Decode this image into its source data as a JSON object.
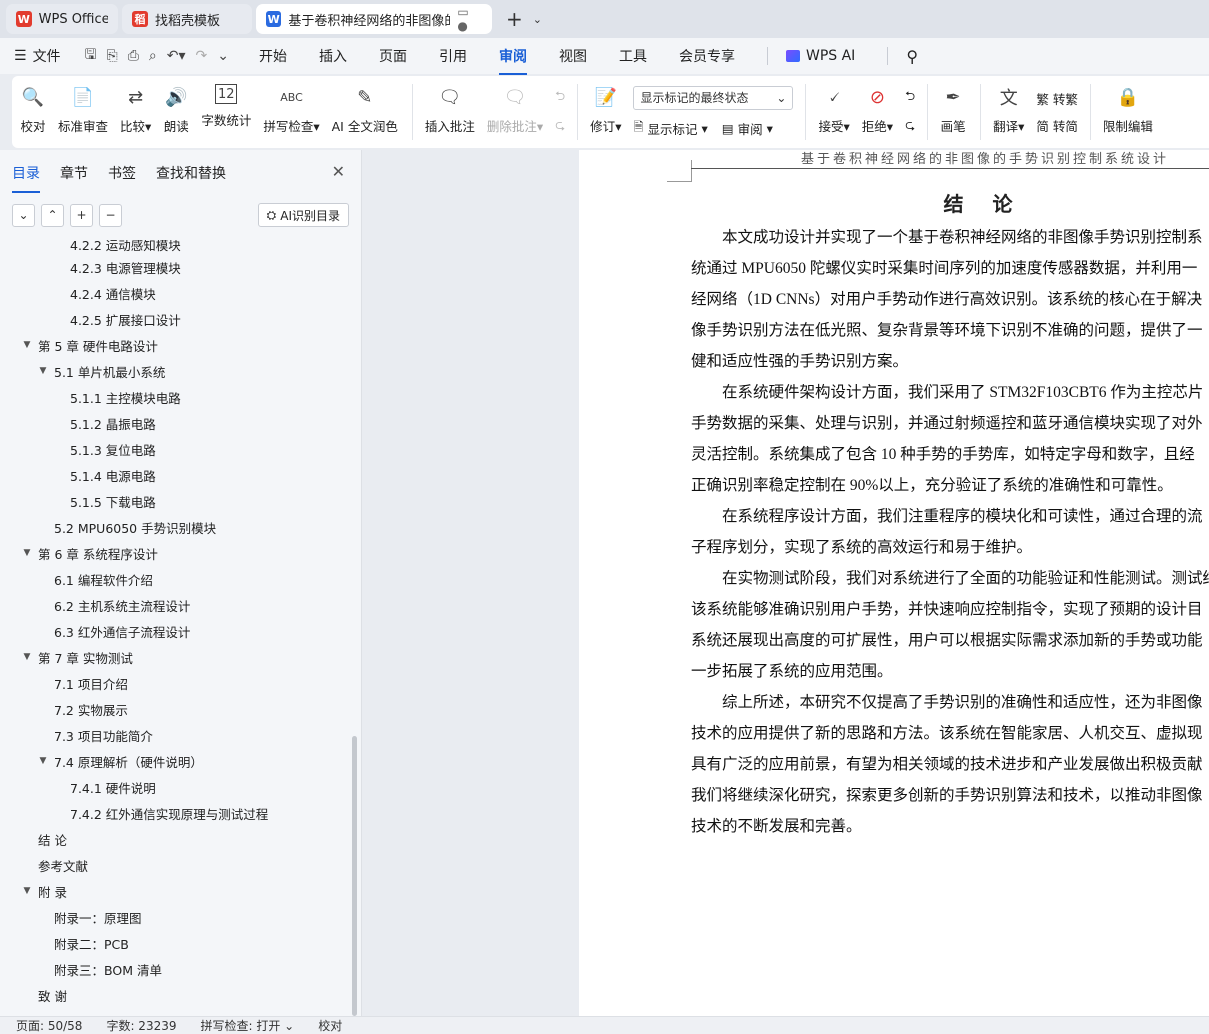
{
  "tabs": [
    {
      "label": "WPS Office",
      "logo": "W",
      "color": "#e23b2e"
    },
    {
      "label": "找稻壳模板",
      "logo": "稻",
      "color": "#e23b2e"
    },
    {
      "label": "基于卷积神经网络的非图像的",
      "logo": "W",
      "color": "#2b6be0",
      "active": true
    }
  ],
  "menu": {
    "file": "文件",
    "items": [
      "开始",
      "插入",
      "页面",
      "引用",
      "审阅",
      "视图",
      "工具",
      "会员专享"
    ],
    "active": "审阅",
    "ai": "WPS AI"
  },
  "ribbon": {
    "proof": "校对",
    "std_review": "标准审查",
    "compare": "比较",
    "read_aloud": "朗读",
    "word_count": "字数统计",
    "spell_check": "拼写检查",
    "ai_polish": "AI 全文润色",
    "insert_comment": "插入批注",
    "delete_comment": "删除批注",
    "revise": "修订",
    "markup_select": "显示标记的最终状态",
    "show_markup": "显示标记",
    "review": "审阅",
    "accept": "接受",
    "reject": "拒绝",
    "pen": "画笔",
    "translate": "翻译",
    "to_traditional": "转繁",
    "to_simplified": "转简",
    "restrict_edit": "限制编辑"
  },
  "sidebar": {
    "tabs": [
      "目录",
      "章节",
      "书签",
      "查找和替换"
    ],
    "active_tab": "目录",
    "ai_toc": "AI识别目录",
    "toc": [
      {
        "level": 3,
        "text": "4.2.2  运动感知模块",
        "arrow": ""
      },
      {
        "level": 3,
        "text": "4.2.3  电源管理模块",
        "arrow": ""
      },
      {
        "level": 3,
        "text": "4.2.4  通信模块",
        "arrow": ""
      },
      {
        "level": 3,
        "text": "4.2.5  扩展接口设计",
        "arrow": ""
      },
      {
        "level": 1,
        "text": "第 5 章  硬件电路设计",
        "arrow": "▼"
      },
      {
        "level": 2,
        "text": "5.1 单片机最小系统",
        "arrow": "▼"
      },
      {
        "level": 3,
        "text": "5.1.1 主控模块电路",
        "arrow": ""
      },
      {
        "level": 3,
        "text": "5.1.2  晶振电路",
        "arrow": ""
      },
      {
        "level": 3,
        "text": "5.1.3  复位电路",
        "arrow": ""
      },
      {
        "level": 3,
        "text": "5.1.4  电源电路",
        "arrow": ""
      },
      {
        "level": 3,
        "text": "5.1.5 下载电路",
        "arrow": ""
      },
      {
        "level": 2,
        "text": "5.2 MPU6050 手势识别模块",
        "arrow": ""
      },
      {
        "level": 1,
        "text": "第 6 章  系统程序设计",
        "arrow": "▼"
      },
      {
        "level": 2,
        "text": "6.1  编程软件介绍",
        "arrow": ""
      },
      {
        "level": 2,
        "text": "6.2  主机系统主流程设计",
        "arrow": ""
      },
      {
        "level": 2,
        "text": "6.3  红外通信子流程设计",
        "arrow": ""
      },
      {
        "level": 1,
        "text": "第 7 章  实物测试",
        "arrow": "▼"
      },
      {
        "level": 2,
        "text": "7.1  项目介绍",
        "arrow": ""
      },
      {
        "level": 2,
        "text": "7.2  实物展示",
        "arrow": ""
      },
      {
        "level": 2,
        "text": "7.3  项目功能简介",
        "arrow": ""
      },
      {
        "level": 2,
        "text": "7.4  原理解析（硬件说明）",
        "arrow": "▼"
      },
      {
        "level": 3,
        "text": "7.4.1 硬件说明",
        "arrow": ""
      },
      {
        "level": 3,
        "text": "7.4.2 红外通信实现原理与测试过程",
        "arrow": ""
      },
      {
        "level": 1,
        "text": "结    论",
        "arrow": ""
      },
      {
        "level": 1,
        "text": "参考文献",
        "arrow": ""
      },
      {
        "level": 1,
        "text": "附    录",
        "arrow": "▼"
      },
      {
        "level": 2,
        "text": "附录一：原理图",
        "arrow": ""
      },
      {
        "level": 2,
        "text": "附录二：PCB",
        "arrow": ""
      },
      {
        "level": 2,
        "text": "附录三：BOM 清单",
        "arrow": ""
      },
      {
        "level": 1,
        "text": "致    谢",
        "arrow": ""
      }
    ]
  },
  "document": {
    "header": "基于卷积神经网络的非图像的手势识别控制系统设计",
    "title": "结  论",
    "paragraphs": [
      [
        "本文成功设计并实现了一个基于卷积神经网络的非图像手势识别控制系",
        "统通过 MPU6050 陀螺仪实时采集时间序列的加速度传感器数据，并利用一",
        "经网络（1D CNNs）对用户手势动作进行高效识别。该系统的核心在于解决",
        "像手势识别方法在低光照、复杂背景等环境下识别不准确的问题，提供了一",
        "健和适应性强的手势识别方案。"
      ],
      [
        "在系统硬件架构设计方面，我们采用了 STM32F103CBT6 作为主控芯片",
        "手势数据的采集、处理与识别，并通过射频遥控和蓝牙通信模块实现了对外",
        "灵活控制。系统集成了包含 10 种手势的手势库，如特定字母和数字，且经",
        "正确识别率稳定控制在 90%以上，充分验证了系统的准确性和可靠性。"
      ],
      [
        "在系统程序设计方面，我们注重程序的模块化和可读性，通过合理的流",
        "子程序划分，实现了系统的高效运行和易于维护。"
      ],
      [
        "在实物测试阶段，我们对系统进行了全面的功能验证和性能测试。测试结",
        "该系统能够准确识别用户手势，并快速响应控制指令，实现了预期的设计目",
        "系统还展现出高度的可扩展性，用户可以根据实际需求添加新的手势或功能",
        "一步拓展了系统的应用范围。"
      ],
      [
        "综上所述，本研究不仅提高了手势识别的准确性和适应性，还为非图像",
        "技术的应用提供了新的思路和方法。该系统在智能家居、人机交互、虚拟现",
        "具有广泛的应用前景，有望为相关领域的技术进步和产业发展做出积极贡献",
        "我们将继续深化研究，探索更多创新的手势识别算法和技术，以推动非图像",
        "技术的不断发展和完善。"
      ]
    ]
  },
  "status": {
    "page": "页面: 50/58",
    "words": "字数: 23239",
    "spell": "拼写检查: 打开",
    "proof": "校对"
  }
}
